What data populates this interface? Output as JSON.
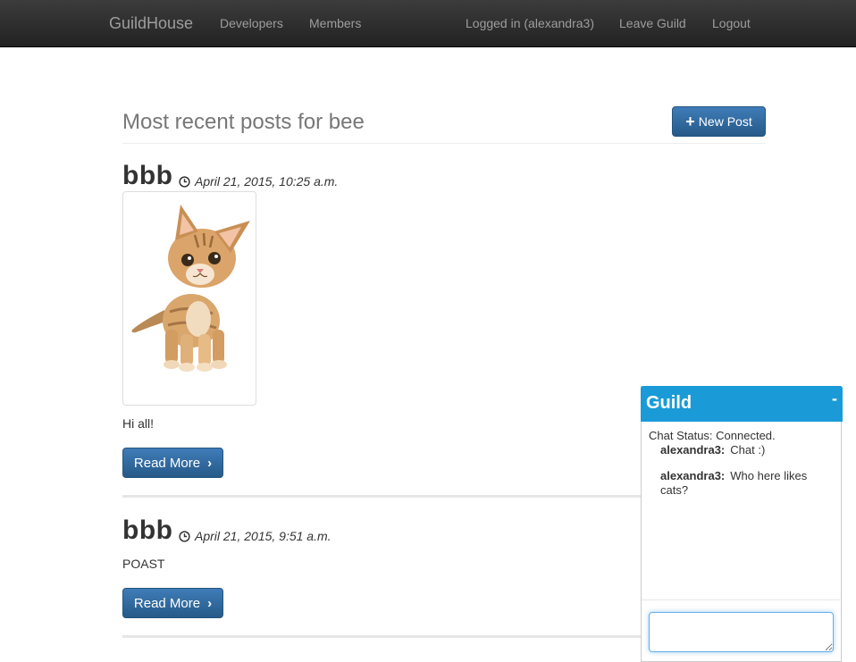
{
  "navbar": {
    "brand": "GuildHouse",
    "links": [
      "Developers",
      "Members"
    ],
    "right_links": [
      "Logged in (alexandra3)",
      "Leave Guild",
      "Logout"
    ]
  },
  "header": {
    "title": "Most recent posts for bee",
    "new_post_label": "New Post"
  },
  "posts": [
    {
      "title": "bbb",
      "date": "April 21, 2015, 10:25 a.m.",
      "body": "Hi all!",
      "read_more_label": "Read More",
      "has_image": true,
      "image_desc": "kitten"
    },
    {
      "title": "bbb",
      "date": "April 21, 2015, 9:51 a.m.",
      "body": "POAST",
      "read_more_label": "Read More",
      "has_image": false
    }
  ],
  "chat": {
    "title": "Guild",
    "minimize_label": "-",
    "status": "Chat Status: Connected.",
    "messages": [
      {
        "user": "alexandra3:",
        "text": "Chat :)"
      },
      {
        "user": "alexandra3:",
        "text": "Who here likes cats?"
      }
    ],
    "input_value": ""
  },
  "colors": {
    "navbar_bg": "#222222",
    "primary_button": "#265a88",
    "chat_header": "#1a9bd7"
  }
}
